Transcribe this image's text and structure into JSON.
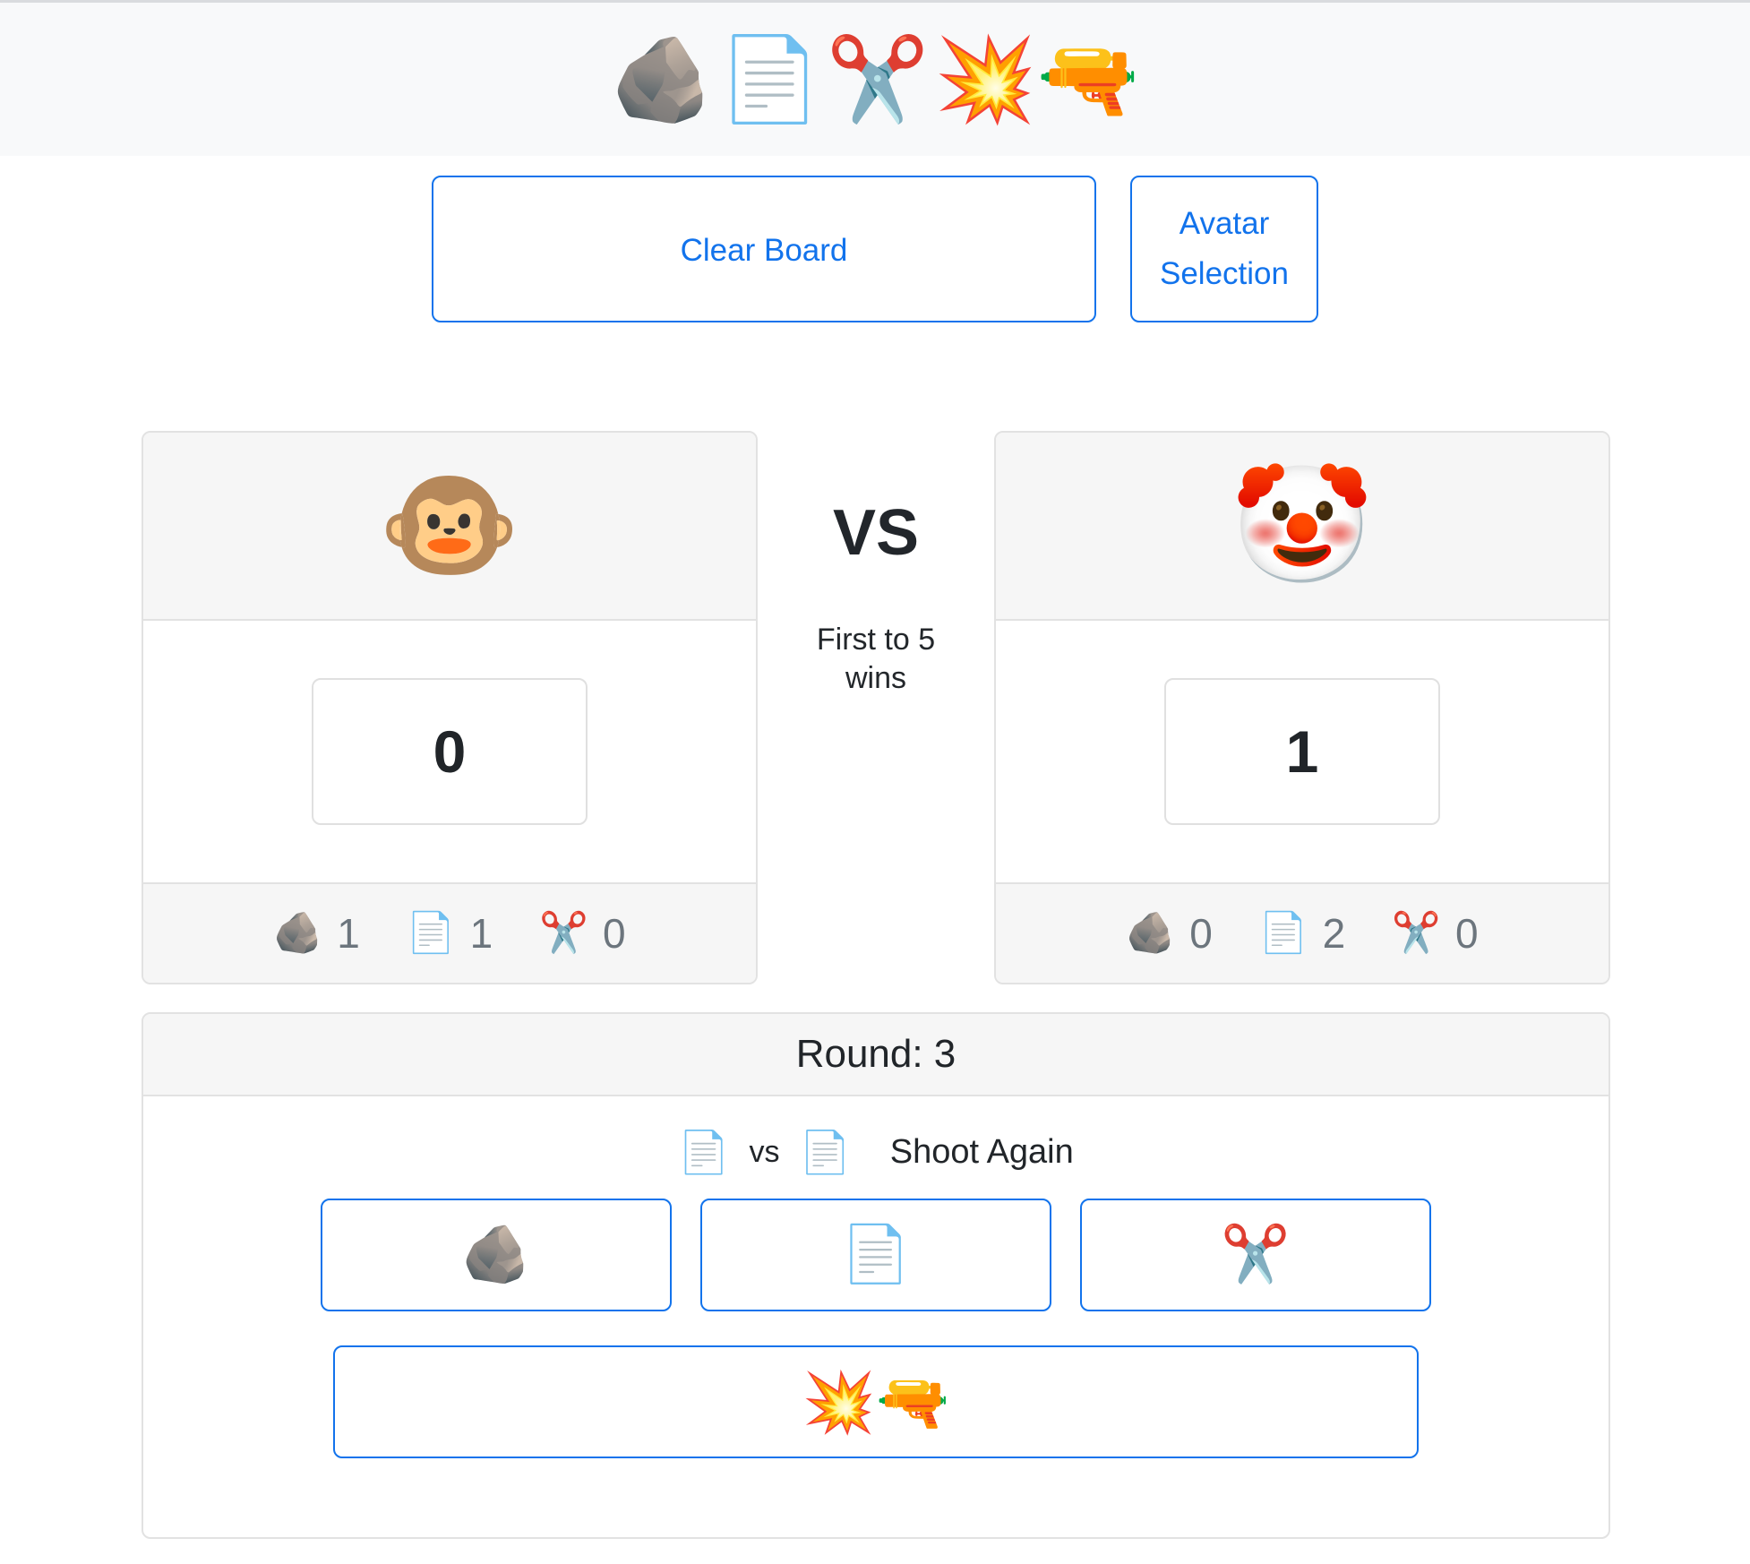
{
  "header": {
    "icons": [
      {
        "name": "rock-icon",
        "glyph": "🪨"
      },
      {
        "name": "paper-icon",
        "glyph": "📄"
      },
      {
        "name": "scissors-icon",
        "glyph": "✂️"
      },
      {
        "name": "gun-icon",
        "glyph": "💥🔫"
      }
    ]
  },
  "toolbar": {
    "clear_board_label": "Clear Board",
    "avatar_line1": "Avatar",
    "avatar_line2": "Selection"
  },
  "board": {
    "vs_label": "VS",
    "vs_sub_line1": "First to 5",
    "vs_sub_line2": "wins",
    "players": [
      {
        "avatar": "🐵",
        "avatar_name": "monkey-face",
        "score": "0",
        "stats": [
          {
            "icon": "🪨",
            "icon_name": "rock-icon",
            "value": "1"
          },
          {
            "icon": "📄",
            "icon_name": "paper-icon",
            "value": "1"
          },
          {
            "icon": "✂️",
            "icon_name": "scissors-icon",
            "value": "0"
          }
        ]
      },
      {
        "avatar": "🤡",
        "avatar_name": "clown-face",
        "score": "1",
        "stats": [
          {
            "icon": "🪨",
            "icon_name": "rock-icon",
            "value": "0"
          },
          {
            "icon": "📄",
            "icon_name": "paper-icon",
            "value": "2"
          },
          {
            "icon": "✂️",
            "icon_name": "scissors-icon",
            "value": "0"
          }
        ]
      }
    ]
  },
  "round": {
    "title": "Round: 3",
    "result": {
      "player1_throw": "📄",
      "vs_text": "vs",
      "player2_throw": "📄",
      "outcome": "Shoot Again"
    },
    "choices": [
      {
        "name": "rock",
        "glyph": "🪨"
      },
      {
        "name": "paper",
        "glyph": "📄"
      },
      {
        "name": "scissors",
        "glyph": "✂️"
      }
    ],
    "gun_choice": {
      "name": "gun",
      "glyph": "💥🔫"
    }
  },
  "colors": {
    "accent_blue": "#1273ec",
    "panel_gray": "#f6f6f6",
    "header_gray": "#f8f9fa",
    "border_gray": "#e2e2e2",
    "muted_text": "#6c757d"
  }
}
